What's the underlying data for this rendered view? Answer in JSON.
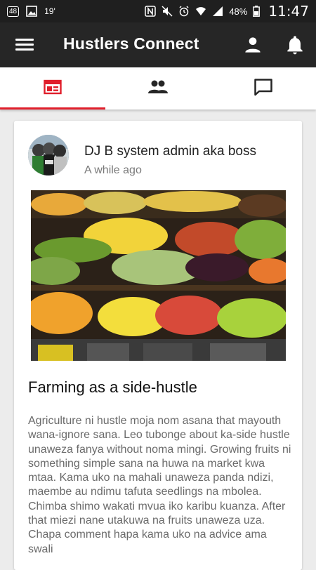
{
  "status_bar": {
    "badge": "48",
    "temperature": "19'",
    "battery": "48%",
    "time": "11:47"
  },
  "app_bar": {
    "title": "Hustlers Connect"
  },
  "tabs": [
    {
      "icon": "feed-icon",
      "active": true
    },
    {
      "icon": "people-icon",
      "active": false
    },
    {
      "icon": "chat-icon",
      "active": false
    }
  ],
  "colors": {
    "accent": "#e01e2b",
    "app_bar": "#262626",
    "status_bar": "#1f1f1f"
  },
  "post": {
    "author": "DJ B system admin aka boss",
    "time_ago": "A while ago",
    "image": "fruit-market-photo",
    "title": "Farming as a side-hustle",
    "body": "Agriculture ni hustle moja nom asana that mayouth wana-ignore sana. Leo tubonge about ka-side hustle unaweza fanya without noma mingi. Growing fruits ni something simple sana na huwa na market kwa mtaa. Kama uko na mahali unaweza panda ndizi, maembe au ndimu tafuta seedlings na mbolea. Chimba shimo wakati mvua iko karibu kuanza. After that miezi nane utakuwa na fruits unaweza uza. Chapa comment hapa kama uko na advice ama swali"
  }
}
